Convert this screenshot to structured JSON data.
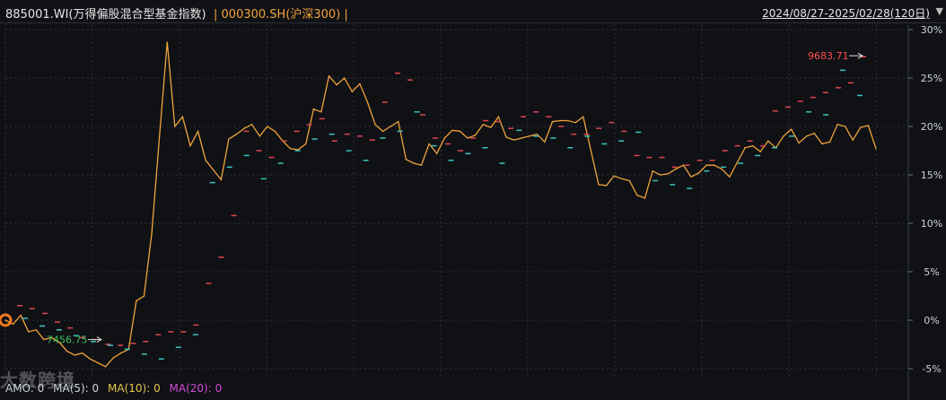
{
  "header": {
    "series1_label": "885001.WI(万得偏股混合型基金指数)",
    "separator": "|",
    "series2_label": "000300.SH(沪深300)",
    "separator2": "|",
    "date_range": "2024/08/27-2025/02/28(120日)",
    "dropdown_glyph": "▼"
  },
  "watermark": "大数跨境",
  "footer": {
    "amo": "AMO: 0",
    "ma5": "MA(5): 0",
    "ma10": "MA(10): 0",
    "ma20": "MA(20): 0"
  },
  "colors": {
    "background": "#0f1115",
    "line": "#f2a33a",
    "up": "#e0474c",
    "down": "#39c6c0",
    "grid": "#2c313a",
    "max_label": "#ff4d4f",
    "min_label": "#3fbf5f",
    "ma10": "#e6c84a",
    "ma20": "#d24bd6"
  },
  "chart_data": {
    "type": "line",
    "y_axis_ticks": [
      "30%",
      "25%",
      "20%",
      "15%",
      "10%",
      "5%",
      "0%",
      "-5%"
    ],
    "ylim": [
      -5,
      30
    ],
    "grid": true,
    "annotations": {
      "max_label": "9683.71",
      "min_label": "7456.75",
      "start_marker": "0%"
    },
    "series": [
      {
        "values": [
          0.0,
          -0.4,
          0.5,
          -1.2,
          -1.0,
          -2.0,
          -1.8,
          -2.3,
          -3.2,
          -3.6,
          -3.4,
          -4.0,
          -4.4,
          -4.8,
          -3.9,
          -3.4,
          -3.0,
          2.0,
          2.5,
          9.0,
          19.0,
          28.7,
          20.0,
          21.0,
          18.0,
          19.5,
          16.5,
          15.5,
          14.5,
          18.7,
          19.2,
          19.8,
          20.2,
          19.0,
          20.0,
          19.5,
          18.5,
          17.7,
          17.6,
          18.2,
          21.8,
          21.5,
          25.2,
          24.3,
          25.0,
          23.6,
          24.4,
          22.5,
          20.2,
          19.5,
          20.0,
          20.5,
          16.6,
          16.2,
          16.0,
          18.2,
          17.2,
          18.8,
          19.6,
          19.5,
          18.8,
          19.1,
          20.2,
          19.9,
          21.0,
          18.9,
          18.6,
          18.8,
          19.0,
          19.2,
          18.4,
          20.5,
          20.6,
          20.6,
          20.4,
          21.0,
          17.5,
          14.0,
          13.9,
          14.9,
          14.6,
          14.4,
          12.9,
          12.6,
          15.4,
          15.0,
          15.1,
          15.6,
          16.0,
          14.8,
          15.2,
          16.0,
          16.0,
          15.6,
          14.8,
          16.3,
          17.8,
          18.0,
          17.4,
          18.5,
          17.8,
          19.0,
          19.7,
          18.3,
          19.0,
          19.3,
          18.2,
          18.4,
          20.2,
          20.0,
          18.6,
          19.9,
          20.1,
          17.7
        ]
      }
    ],
    "ma5_marks": [
      1.5,
      1.2,
      0.7,
      -0.2,
      -0.8,
      -1.8,
      -2.0,
      -2.5,
      -2.6,
      -2.4,
      -2.2,
      -1.5,
      -1.2,
      -1.2,
      -0.5,
      3.8,
      6.5,
      10.8,
      19.5,
      17.5,
      16.8,
      18.5,
      19.5,
      20.2,
      20.8,
      18.5,
      19.2,
      19.0,
      18.6,
      22.5,
      25.5,
      24.8,
      21.2,
      18.8,
      18.2,
      17.5,
      18.8,
      20.6,
      20.5,
      19.8,
      21.0,
      21.5,
      21.0,
      20.0,
      19.2,
      19.2,
      19.8,
      20.4,
      19.5,
      17.0,
      16.8,
      16.8,
      15.8,
      16.0,
      16.5,
      16.5,
      17.5,
      18.0,
      18.5,
      18.0,
      21.6,
      22.0,
      22.6,
      23.0,
      23.5,
      24.0,
      24.5,
      27.2
    ],
    "ma10_marks": [
      0.2,
      -0.6,
      -1.0,
      -1.6,
      -2.2,
      -2.6,
      -3.0,
      -3.5,
      -4.0,
      -2.8,
      -1.5,
      14.2,
      15.8,
      17.0,
      14.6,
      16.2,
      17.5,
      18.7,
      19.2,
      17.5,
      16.5,
      18.8,
      19.5,
      21.5,
      18.0,
      16.5,
      17.2,
      17.8,
      16.2,
      19.6,
      19.0,
      18.8,
      17.8,
      19.0,
      18.2,
      18.5,
      19.4,
      14.4,
      14.0,
      13.6,
      15.4,
      15.8,
      16.2,
      17.0,
      17.8,
      19.0,
      21.5,
      21.2,
      25.8,
      23.2
    ]
  }
}
